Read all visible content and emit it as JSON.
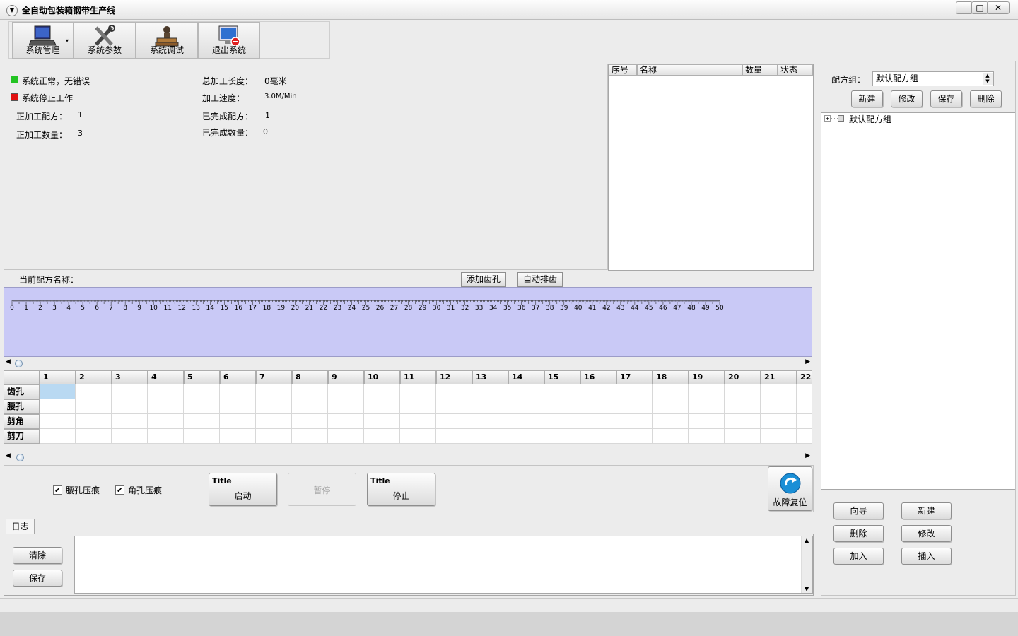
{
  "window": {
    "title": "全自动包装箱钢带生产线",
    "minimize": "—",
    "maximize": "□",
    "close": "✕"
  },
  "toolbar": {
    "items": [
      {
        "label": "系统管理",
        "icon": "laptop-icon"
      },
      {
        "label": "系统参数",
        "icon": "tools-icon"
      },
      {
        "label": "系统调试",
        "icon": "stamp-icon"
      },
      {
        "label": "退出系统",
        "icon": "monitor-exit-icon"
      }
    ]
  },
  "status": {
    "normal": "系统正常，无错误",
    "stopped": "系统停止工作",
    "current_recipe_label": "正加工配方：",
    "current_recipe_value": "1",
    "current_qty_label": "正加工数量：",
    "current_qty_value": "3",
    "total_length_label": "总加工长度：",
    "total_length_value": "0毫米",
    "speed_label": "加工速度：",
    "speed_value": "3.0M/Min",
    "done_recipe_label": "已完成配方：",
    "done_recipe_value": "1",
    "done_qty_label": "已完成数量：",
    "done_qty_value": "0",
    "colors": {
      "normal": "#22c322",
      "stopped": "#e01010"
    }
  },
  "queue_table": {
    "headers": [
      "序号",
      "名称",
      "数量",
      "状态"
    ]
  },
  "recipe": {
    "current_name_label": "当前配方名称：",
    "add_hole": "添加齿孔",
    "auto_arrange": "自动排齿"
  },
  "ruler": {
    "labels": [
      "0",
      "1",
      "2",
      "3",
      "4",
      "5",
      "6",
      "7",
      "8",
      "9",
      "10",
      "11",
      "12",
      "13",
      "14",
      "15",
      "16",
      "17",
      "18",
      "19",
      "20",
      "21",
      "22",
      "23",
      "24",
      "25",
      "26",
      "27",
      "28",
      "29",
      "30",
      "31",
      "32",
      "33",
      "34",
      "35",
      "36",
      "37",
      "38",
      "39",
      "40",
      "41",
      "42",
      "43",
      "44",
      "45",
      "46",
      "47",
      "48",
      "49",
      "50"
    ],
    "color": "#c9c9f6"
  },
  "grid": {
    "columns": [
      "1",
      "2",
      "3",
      "4",
      "5",
      "6",
      "7",
      "8",
      "9",
      "10",
      "11",
      "12",
      "13",
      "14",
      "15",
      "16",
      "17",
      "18",
      "19",
      "20",
      "21",
      "22"
    ],
    "rows": [
      "齿孔",
      "腰孔",
      "剪角",
      "剪刀"
    ]
  },
  "controls": {
    "waist_press": "腰孔压痕",
    "corner_press": "角孔压痕",
    "start_title": "Title",
    "start_label": "启动",
    "pause_label": "暂停",
    "stop_title": "Title",
    "stop_label": "停止",
    "fault_reset": "故障复位"
  },
  "log": {
    "tab": "日志",
    "clear": "清除",
    "save": "保存"
  },
  "right_panel": {
    "group_label": "配方组：",
    "group_value": "默认配方组",
    "new": "新建",
    "edit": "修改",
    "save": "保存",
    "delete": "删除",
    "tree_root": "默认配方组",
    "wizard": "向导",
    "new2": "新建",
    "delete2": "删除",
    "edit2": "修改",
    "add": "加入",
    "insert": "插入"
  }
}
